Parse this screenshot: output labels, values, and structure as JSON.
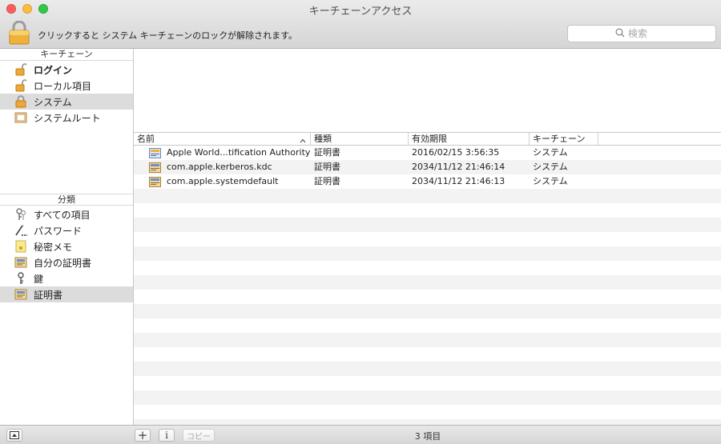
{
  "window": {
    "title": "キーチェーンアクセス"
  },
  "toolbar": {
    "lock_message": "クリックすると システム キーチェーンのロックが解除されます。",
    "search_placeholder": "検索"
  },
  "sidebar": {
    "keychains_header": "キーチェーン",
    "keychains": [
      {
        "label": "ログイン",
        "icon": "open-lock-icon",
        "bold": true
      },
      {
        "label": "ローカル項目",
        "icon": "open-lock-icon"
      },
      {
        "label": "システム",
        "icon": "closed-lock-icon",
        "selected": true
      },
      {
        "label": "システムルート",
        "icon": "cabinet-icon"
      }
    ],
    "category_header": "分類",
    "categories": [
      {
        "label": "すべての項目",
        "icon": "all-items-icon"
      },
      {
        "label": "パスワード",
        "icon": "password-icon"
      },
      {
        "label": "秘密メモ",
        "icon": "secure-note-icon"
      },
      {
        "label": "自分の証明書",
        "icon": "my-certificate-icon"
      },
      {
        "label": "鍵",
        "icon": "key-icon"
      },
      {
        "label": "証明書",
        "icon": "certificate-icon",
        "selected": true
      }
    ]
  },
  "table": {
    "columns": [
      "名前",
      "種類",
      "有効期限",
      "キーチェーン"
    ],
    "rows": [
      {
        "name": "Apple World...tification Authority",
        "kind": "証明書",
        "expires": "2016/02/15 3:56:35",
        "keychain": "システム",
        "icon": "certificate-blue-icon"
      },
      {
        "name": "com.apple.kerberos.kdc",
        "kind": "証明書",
        "expires": "2034/11/12 21:46:14",
        "keychain": "システム",
        "icon": "certificate-icon"
      },
      {
        "name": "com.apple.systemdefault",
        "kind": "証明書",
        "expires": "2034/11/12 21:46:13",
        "keychain": "システム",
        "icon": "certificate-icon"
      }
    ]
  },
  "bottombar": {
    "add_label": "+",
    "info_label": "i",
    "copy_label": "コピー",
    "item_count": "3 項目"
  }
}
